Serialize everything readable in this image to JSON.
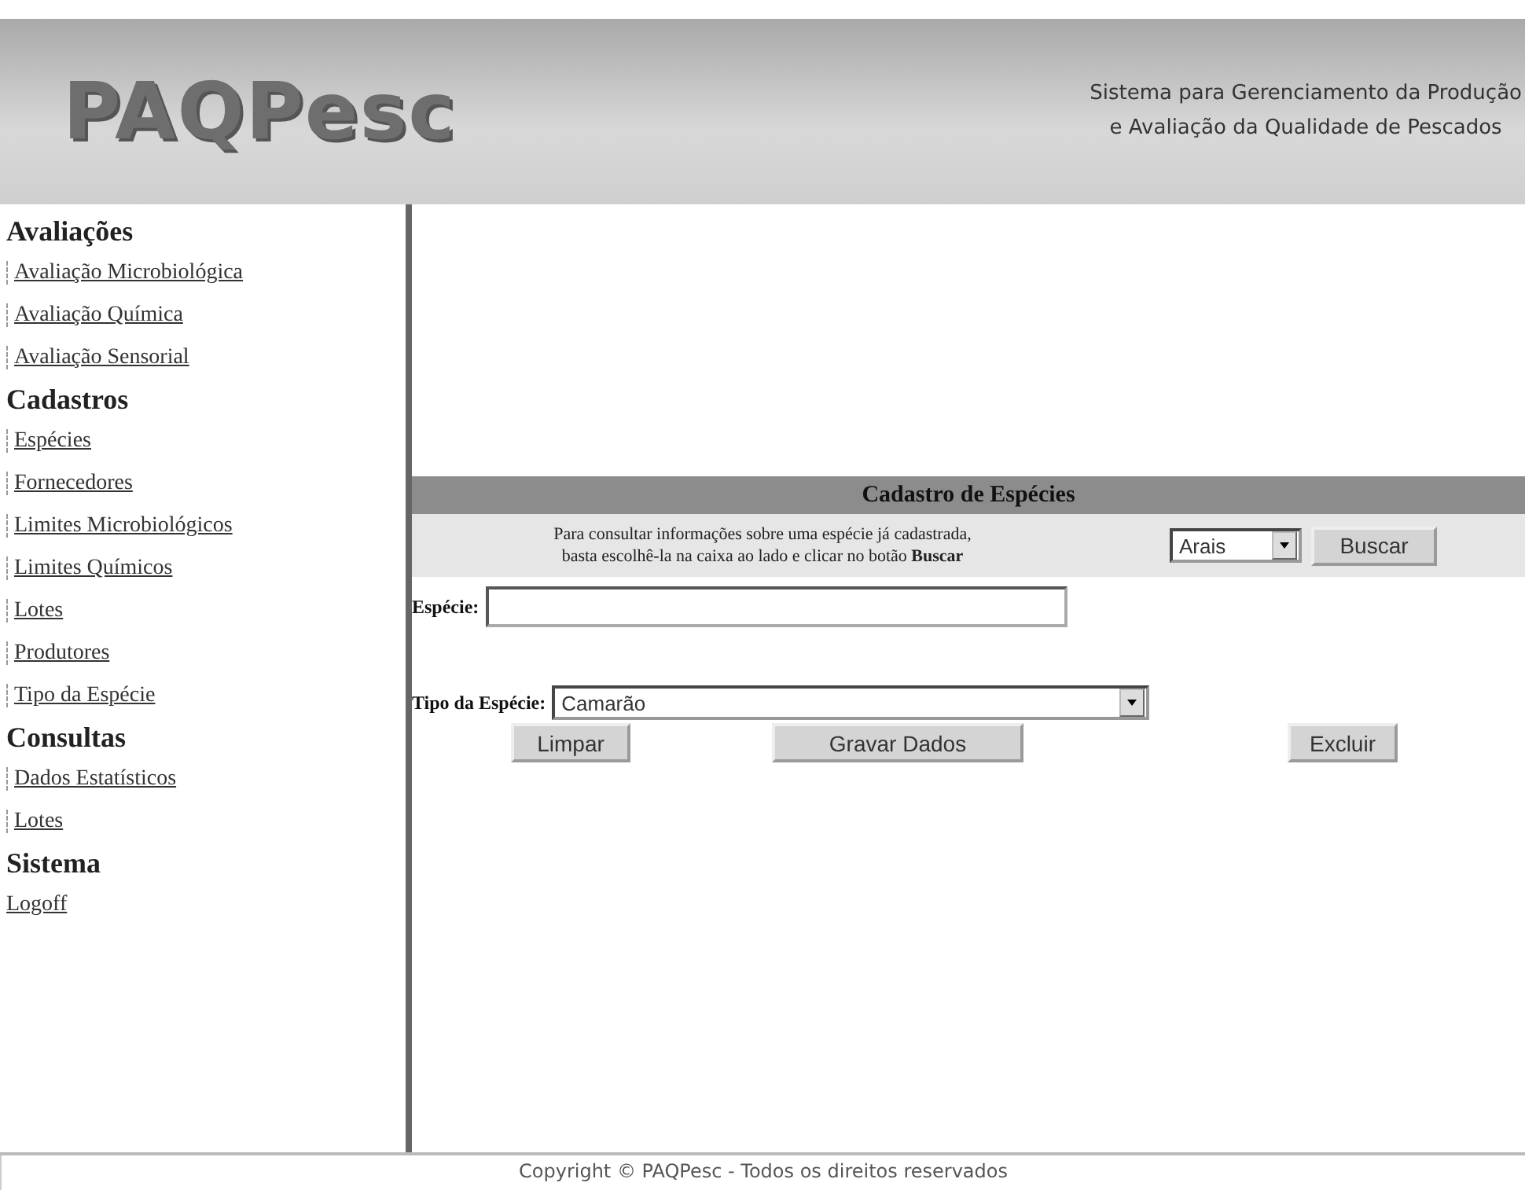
{
  "header": {
    "logo": "PAQPesc",
    "subtitle_lines": [
      "Sistema para Gerenciamento da Produção",
      "e Avaliação da Qualidade de Pescados"
    ]
  },
  "sidebar": {
    "groups": [
      {
        "title": "Avaliações",
        "items": [
          {
            "label": "Avaliação Microbiológica",
            "kind": "dash"
          },
          {
            "label": "Avaliação Química",
            "kind": "dash"
          },
          {
            "label": "Avaliação Sensorial",
            "kind": "dash"
          }
        ]
      },
      {
        "title": "Cadastros",
        "items": [
          {
            "label": "Espécies",
            "kind": "dash"
          },
          {
            "label": "Fornecedores",
            "kind": "dash"
          },
          {
            "label": "Limites Microbiológicos",
            "kind": "dash"
          },
          {
            "label": "Limites Químicos",
            "kind": "dash"
          },
          {
            "label": "Lotes",
            "kind": "dash"
          },
          {
            "label": "Produtores",
            "kind": "dash"
          },
          {
            "label": "Tipo da Espécie",
            "kind": "dash"
          }
        ]
      },
      {
        "title": "Consultas",
        "items": [
          {
            "label": "Dados Estatísticos",
            "kind": "dash"
          },
          {
            "label": "Lotes",
            "kind": "dash"
          }
        ]
      },
      {
        "title": "Sistema",
        "items": [
          {
            "label": "Logoff",
            "kind": "plain"
          }
        ]
      }
    ]
  },
  "form": {
    "title": "Cadastro de Espécies",
    "hint": "Para consultar informações sobre uma espécie já cadastrada,\nbasta escolhê-la na caixa ao lado e clicar no botão **Buscar**",
    "search_select": "Arais",
    "search_button": "Buscar",
    "species_label": "Espécie:",
    "type_label": "Tipo da Espécie:",
    "type_select": "Camarão",
    "buttons": [
      "Limpar",
      "Gravar Dados",
      "Excluir"
    ]
  },
  "footer": "Copyright © PAQPesc - Todos os direitos reservados"
}
